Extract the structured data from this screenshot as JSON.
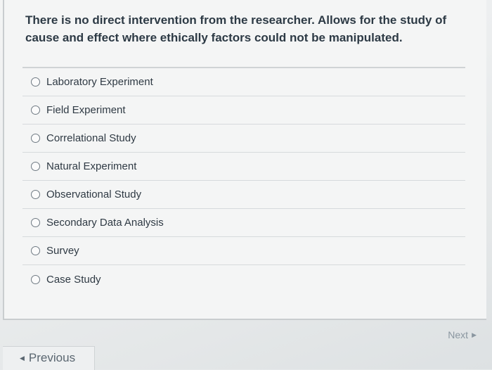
{
  "question": {
    "text": "There is no direct intervention from the researcher. Allows for the study of cause and effect where ethically factors could not be manipulated."
  },
  "options": [
    {
      "label": "Laboratory Experiment"
    },
    {
      "label": "Field Experiment"
    },
    {
      "label": "Correlational Study"
    },
    {
      "label": "Natural Experiment"
    },
    {
      "label": "Observational Study"
    },
    {
      "label": "Secondary Data Analysis"
    },
    {
      "label": "Survey"
    },
    {
      "label": "Case Study"
    }
  ],
  "navigation": {
    "next_label": "Next",
    "previous_label": "Previous"
  }
}
